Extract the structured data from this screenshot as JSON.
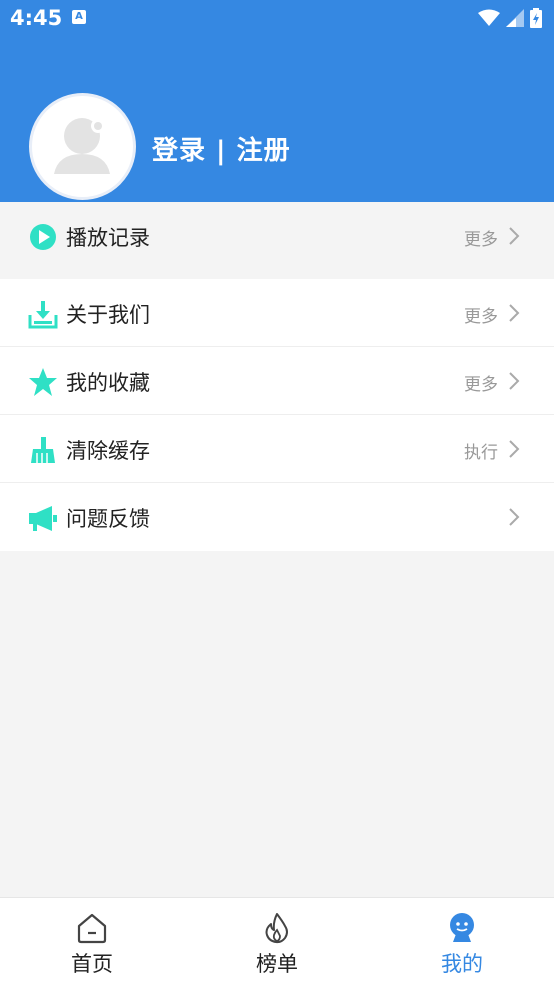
{
  "status": {
    "time": "4:45",
    "notif": "A"
  },
  "profile": {
    "login_text": "登录 | 注册"
  },
  "menu": [
    {
      "label": "播放记录",
      "action": "更多",
      "icon": "play-circle-icon"
    },
    {
      "label": "关于我们",
      "action": "更多",
      "icon": "download-tray-icon"
    },
    {
      "label": "我的收藏",
      "action": "更多",
      "icon": "star-icon"
    },
    {
      "label": "清除缓存",
      "action": "执行",
      "icon": "broom-icon"
    },
    {
      "label": "问题反馈",
      "action": "",
      "icon": "megaphone-icon"
    }
  ],
  "tabs": [
    {
      "label": "首页",
      "icon": "home-icon",
      "active": false
    },
    {
      "label": "榜单",
      "icon": "flame-icon",
      "active": false
    },
    {
      "label": "我的",
      "icon": "profile-icon",
      "active": true
    }
  ],
  "colors": {
    "primary": "#3588e2",
    "icon_accent": "#2fe0c5"
  }
}
